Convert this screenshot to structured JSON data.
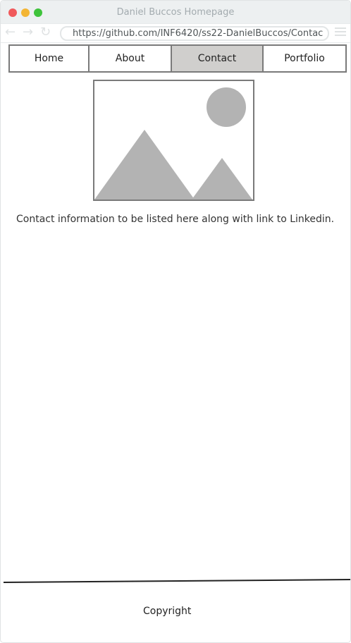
{
  "window": {
    "title": "Daniel Buccos Homepage",
    "controls": [
      "close",
      "minimize",
      "maximize"
    ]
  },
  "toolbar": {
    "back_icon": "back-arrow-icon",
    "forward_icon": "forward-arrow-icon",
    "reload_icon": "reload-icon",
    "url": "https://github.com/INF6420/ss22-DanielBuccos/Contac",
    "menu_icon": "hamburger-menu-icon"
  },
  "nav": {
    "items": [
      {
        "label": "Home",
        "active": false
      },
      {
        "label": "About",
        "active": false
      },
      {
        "label": "Contact",
        "active": true
      },
      {
        "label": "Portfolio",
        "active": false
      }
    ]
  },
  "hero": {
    "icon": "image-placeholder-icon"
  },
  "main": {
    "text": "Contact information to be listed here along with link to Linkedin."
  },
  "footer": {
    "copyright": "Copyright"
  },
  "colors": {
    "titlebar": "#edf0f1",
    "nav_border": "#7a7a7a",
    "nav_active": "#d0cfcd",
    "placeholder_shape": "#b3b3b3"
  }
}
